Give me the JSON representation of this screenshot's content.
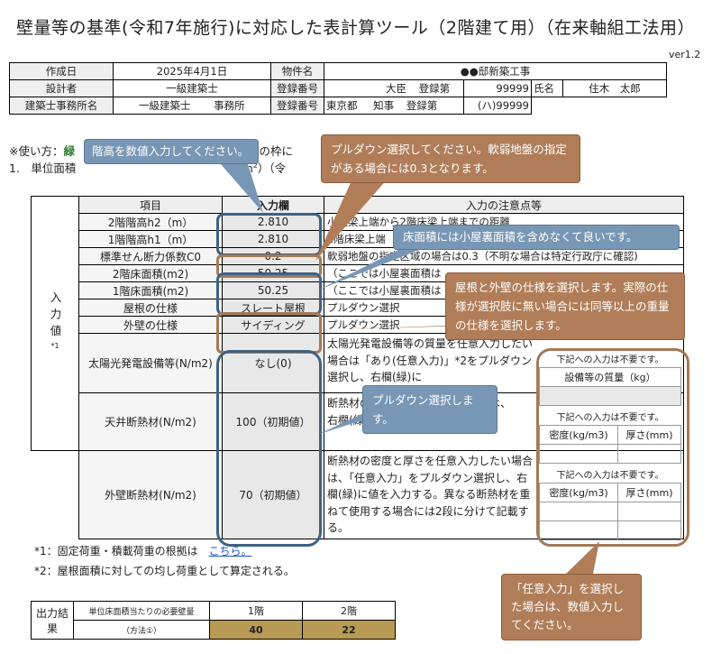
{
  "title": "壁量等の基準(令和7年施行)に対応した表計算ツール（2階建て用）（在来軸組工法用）",
  "version": "ver1.2",
  "info": {
    "created_label": "作成日",
    "created_value": "2025年4月1日",
    "property_label": "物件名",
    "property_value": "●●邸新築工事",
    "designer_label": "設計者",
    "designer_value": "一級建築士",
    "reg_label": "登録番号",
    "reg_minister": "大臣",
    "reg_text": "登録第",
    "reg_no": "99999",
    "name_label": "氏名",
    "name_value": "住木　太郎",
    "office_label": "建築士事務所名",
    "office_value": "一級建築士",
    "office_suffix": "事務所",
    "reg_label2": "登録番号",
    "pref": "東京都",
    "governor": "知事",
    "reg_text2": "登録第",
    "reg_no2": "(ハ)99999"
  },
  "notes": {
    "usage_prefix": "※使い方：",
    "usage_green": "緑",
    "usage_suffix": "ジの枠に",
    "line1_prefix": "1.　単位面積",
    "line1_mid": "/m",
    "line1_sup": "2",
    "line1_suffix": "）（令",
    "line1_end": "王）"
  },
  "table": {
    "h_item": "項目",
    "h_input": "入力欄",
    "h_notes": "入力の注意点等",
    "side_label": "入力値",
    "side_sup": "*1",
    "rows": [
      {
        "label": "2階階高h2（m）",
        "value": "2.810",
        "note": "小屋梁上端から2階床梁上端までの距離"
      },
      {
        "label": "1階階高h1（m）",
        "value": "2.810",
        "note": "2階床梁上端"
      },
      {
        "label": "標準せん断力係数C0",
        "value": "0.2",
        "note": "軟弱地盤の指定区域の場合は0.3（不明な場合は特定行政庁に確認)"
      },
      {
        "label": "2階床面積(m2)",
        "value": "50.25",
        "note": "（ここでは小屋裏面積は"
      },
      {
        "label": "1階床面積(m2)",
        "value": "50.25",
        "note": "（ここでは小屋裏面積は"
      },
      {
        "label": "屋根の仕様",
        "value": "スレート屋根",
        "note": "プルダウン選択"
      },
      {
        "label": "外壁の仕様",
        "value": "サイディング",
        "note": "プルダウン選択"
      }
    ],
    "solar_label": "太陽光発電設備等(N/m2)",
    "solar_value": "なし(0)",
    "solar_note": "太陽光発電設備等の質量を任意入力したい場合は「あり(任意入力)」*2をプルダウン選択し、右欄(緑)に",
    "ceiling_label": "天井断熱材(N/m2)",
    "ceiling_value": "100（初期値）",
    "ceiling_note": "断熱材の　　　　　　　たい場合は、　　　　　　　右欄(緑)に値を入力する。",
    "wall_label": "外壁断熱材(N/m2)",
    "wall_value": "70（初期値）",
    "wall_note": "断熱材の密度と厚さを任意入力したい場合は、「任意入力」をプルダウン選択し、右欄(緑)に値を入力する。異なる断熱材を重ねて使用する場合には2段に分けて記載する。",
    "sub_note": "下記への入力は不要です。",
    "mass_header": "設備等の質量（kg）",
    "density_header": "密度(kg/m3)",
    "thick_header": "厚さ(mm)"
  },
  "footnotes": {
    "f1": "*1：固定荷重・積載荷重の根拠は",
    "f1_link": "こちら。",
    "f2": "*2：屋根面積に対しての均し荷重として算定される。"
  },
  "output": {
    "label": "出力結果",
    "desc1": "単位床面積当たりの必要壁量",
    "desc2": "（方法①）",
    "floor1_label": "1階",
    "floor2_label": "2階",
    "floor1_value": "40",
    "floor2_value": "22"
  },
  "callouts": {
    "height": "階高を数値入力してください。",
    "pulldown_soil": "プルダウン選択してください。軟弱地盤の指定がある場合には0.3となります。",
    "floor_area": "床面積には小屋裏面積を含めなくて良いです。",
    "roof_wall": "屋根と外壁の仕様を選択します。実際の仕様が選択肢に無い場合には同等以上の重量の仕様を選択します。",
    "pulldown": "プルダウン選択します。",
    "arbitrary": "「任意入力」を選択した場合は、数値入力してください。"
  }
}
